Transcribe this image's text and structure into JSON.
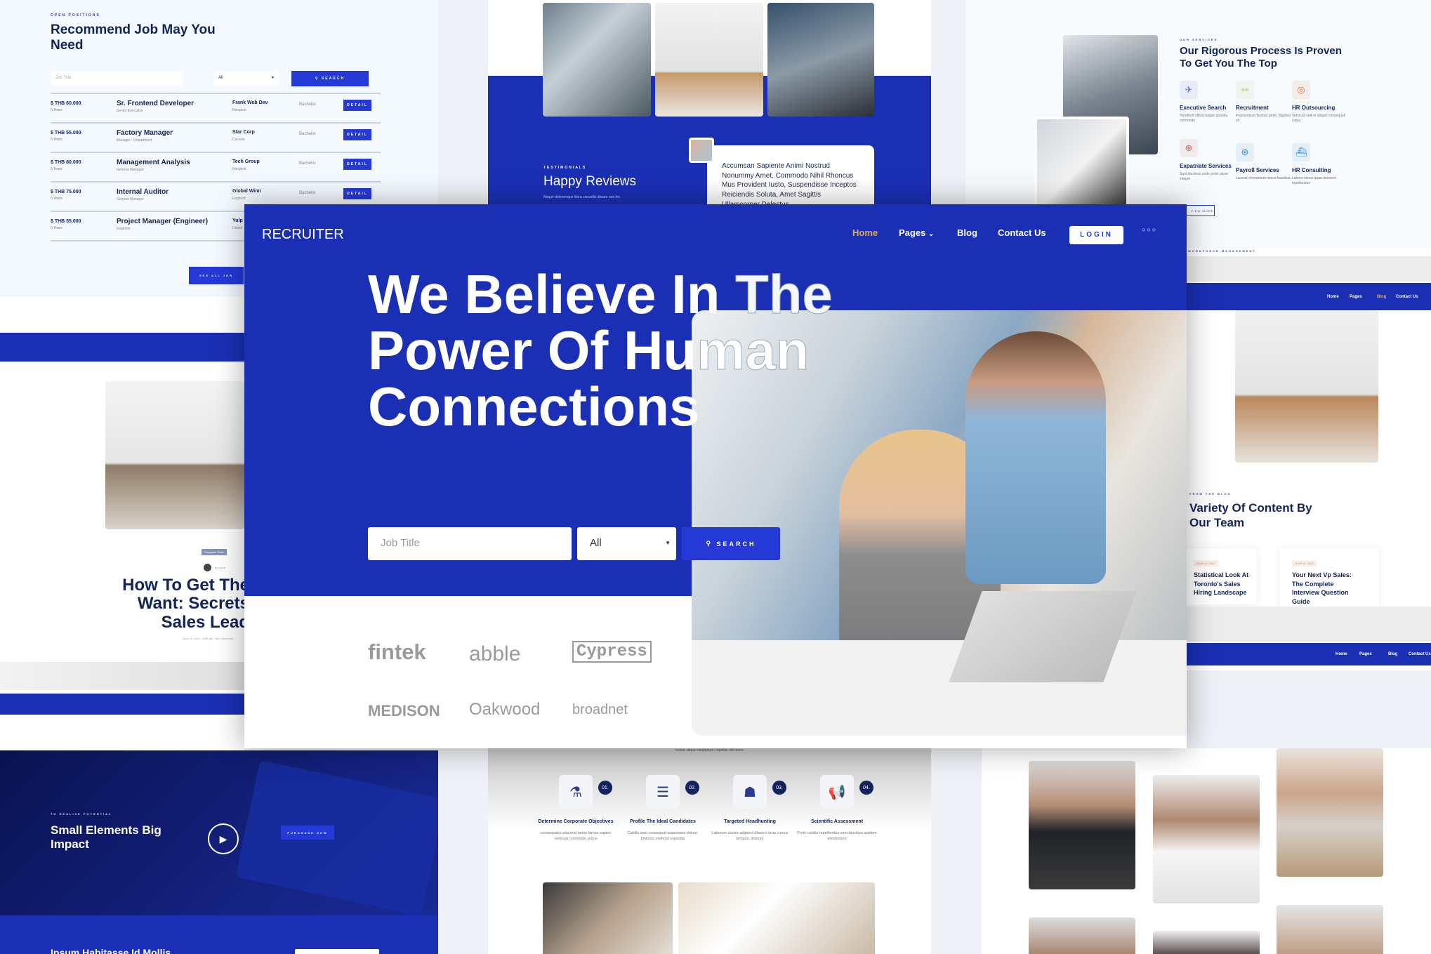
{
  "jobs_panel": {
    "eyebrow": "OPEN POSITIONS",
    "title": "Recommend Job May You Need",
    "search_placeholder": "Job Title",
    "select_value": "All",
    "search_label": "SEARCH",
    "see_all_label": "SEE ALL JOB",
    "jobs": [
      {
        "salary": "$ THB 60.000",
        "years": "5 Years",
        "title": "Sr. Frontend Developer",
        "level": "Senior Executive",
        "company": "Frank Web Dev",
        "location": "Bangkok",
        "degree": "Bachelor",
        "action": "DETAIL"
      },
      {
        "salary": "$ THB 55.000",
        "years": "5 Years",
        "title": "Factory Manager",
        "level": "Manager - Department",
        "company": "Star Corp",
        "location": "Canada",
        "degree": "Bachelor",
        "action": "DETAIL"
      },
      {
        "salary": "$ THB 80.000",
        "years": "5 Years",
        "title": "Management Analysis",
        "level": "General Manager",
        "company": "Tech Group",
        "location": "Bangkok",
        "degree": "Bachelor",
        "action": "DETAIL"
      },
      {
        "salary": "$ THB 75.000",
        "years": "5 Years",
        "title": "Internal Auditor",
        "level": "General Manager",
        "company": "Global Winn",
        "location": "England",
        "degree": "Bachelor",
        "action": "DETAIL"
      },
      {
        "salary": "$ THB 55.000",
        "years": "5 Years",
        "title": "Project Manager (Engineer)",
        "level": "Engineer",
        "company": "Yulp",
        "location": "United",
        "degree": "",
        "action": ""
      }
    ]
  },
  "testimonial_panel": {
    "eyebrow": "TESTIMONIALS",
    "title": "Happy Reviews",
    "text": "Neque doloremque litora convallis dictum non hic",
    "quote": "Accumsan Sapiente Animi Nostrud Nonummy Amet. Commodo Nihil Rhoncus Mus Provident Iusto, Suspendisse Inceptos Reiciendis Soluta, Amet Sagittis Ullamcorper Delectus"
  },
  "services_panel": {
    "eyebrow": "OUR SERVICES",
    "title": "Our Rigorous Process Is Proven To Get You The Top",
    "view_more": "VIEW MORE",
    "services": [
      {
        "name": "Executive Search",
        "desc": "Hendrerit officia eaque gravida commodo",
        "icon": "airplane-icon",
        "color": "#5b6fd6"
      },
      {
        "name": "Recruitment",
        "desc": "Praesentium facilisis pede, dapibus sit",
        "icon": "dumbbell-icon",
        "color": "#b5c24a"
      },
      {
        "name": "HR Outsourcing",
        "desc": "Vehicula velit in aliquet consequat culpa",
        "icon": "lifebuoy-icon",
        "color": "#e0743a"
      },
      {
        "name": "Expatriate Services",
        "desc": "Sunt ducimus unde pede curae integer",
        "icon": "globe-plane-icon",
        "color": "#c46a5a"
      },
      {
        "name": "Payroll Services",
        "desc": "Lacerat elementum minus faucibus,",
        "icon": "basketball-icon",
        "color": "#3e8fc4"
      },
      {
        "name": "HR Consulting",
        "desc": "Labore minus quae dolorem repellendus",
        "icon": "ship-icon",
        "color": "#3e8fc4"
      }
    ]
  },
  "workforce_label": "WORKFORCE MANAGEMENT",
  "main": {
    "logo": "RECRUITER",
    "nav": [
      {
        "label": "Home",
        "active": true
      },
      {
        "label": "Pages",
        "dropdown": true
      },
      {
        "label": "Blog"
      },
      {
        "label": "Contact Us"
      }
    ],
    "login_label": "LOGIN",
    "hero_line1a": "We Believe In",
    "hero_line1b": "The",
    "hero_line2a": "Power Of Hu",
    "hero_line2b": "man",
    "hero_line3": "Connections",
    "search_placeholder": "Job Title",
    "select_value": "All",
    "search_label": "SEARCH",
    "accent": "#1b2fb4",
    "active_nav_color": "#e9a94d",
    "logos": [
      "fintek",
      "abble",
      "Cypress",
      "MEDISON",
      "Oakwood",
      "broadnet"
    ]
  },
  "blog_left": {
    "tag": "Computer Skills",
    "author": "by oscar",
    "title": "How To Get The Want: Secrets Sales Lead",
    "meta": "June 11, 2021 · 8:59 pm · No Comments"
  },
  "blog_right": {
    "eyebrow": "FROM THE BLOG",
    "title": "Variety Of Content By Our Team",
    "posts": [
      {
        "date": "JUNE 11, 2021",
        "title": "Statistical Look At Toronto's Sales Hiring Landscape"
      },
      {
        "date": "JUNE 11, 2021",
        "title": "Your Next Vp Sales: The Complete Interview Question Guide"
      }
    ],
    "mini_nav": [
      "Home",
      "Pages",
      "Blog",
      "Contact Us"
    ]
  },
  "video_panel": {
    "eyebrow": "TO REALIZE POTENTIAL",
    "title": "Small Elements Big Impact",
    "purchase_label": "PURCHASE NOW",
    "footer_title": "Ipsum Habitasse Id Mollis"
  },
  "process_panel": {
    "intro": "luctus, atque voluptatum, repellat, elit nemo",
    "steps": [
      {
        "num": "01.",
        "title": "Determine Corporate Objectives",
        "desc": "consequatur placerat netus fames sapien vehicula commodo purus",
        "icon": "flask-globe-icon"
      },
      {
        "num": "02.",
        "title": "Profile The Ideal Candidates",
        "desc": "Cubilia sem consequat asperiores dolore. Dolores eleifend expedita",
        "icon": "document-list-icon"
      },
      {
        "num": "03.",
        "title": "Targeted Headhunting",
        "desc": "Laborum auctor adipisci ullamco urna cursus tempus, dolores",
        "icon": "box-person-icon"
      },
      {
        "num": "04.",
        "title": "Scientific Assessment",
        "desc": "Proin cubilia repellendus sem faucibus quidem elementum",
        "icon": "megaphone-icon"
      }
    ]
  }
}
